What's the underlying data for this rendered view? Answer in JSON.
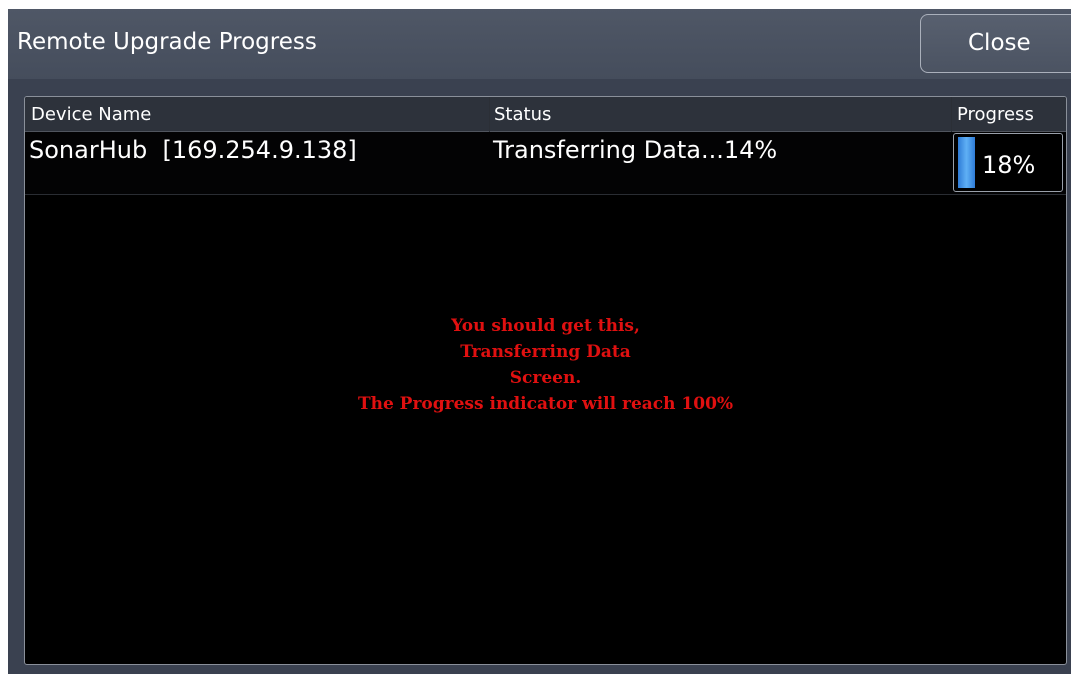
{
  "window": {
    "title": "Remote Upgrade Progress",
    "close_label": "Close"
  },
  "table": {
    "columns": [
      "Device Name",
      "Status",
      "Progress"
    ],
    "rows": [
      {
        "device_name": "SonarHub  [169.254.9.138]",
        "status": "Transferring Data...14%",
        "progress_label": "18%",
        "progress_fraction": 0.18
      }
    ]
  },
  "annotation": {
    "lines": [
      "You should get this,",
      "Transferring Data",
      "Screen.",
      "The Progress indicator will reach 100%"
    ],
    "color": "#e01010"
  },
  "colors": {
    "titlebar": "#4f5766",
    "panel_background": "#000000",
    "progress_fill": "#2e7bd6"
  }
}
